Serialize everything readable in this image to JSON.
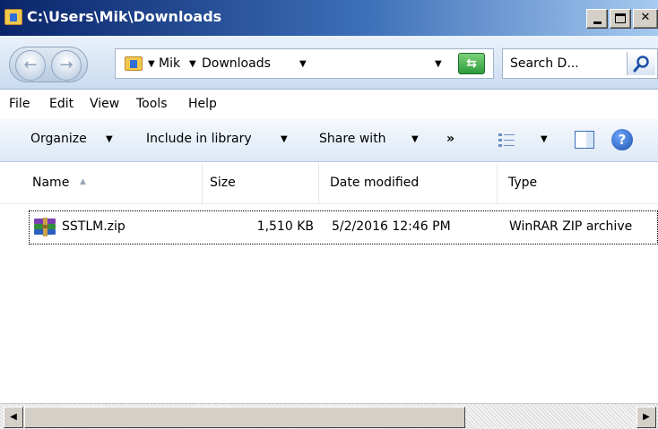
{
  "window": {
    "title": "C:\\Users\\Mik\\Downloads"
  },
  "address": {
    "crumbs": [
      "Mik",
      "Downloads"
    ]
  },
  "search": {
    "placeholder": "Search D..."
  },
  "menu": {
    "items": [
      "File",
      "Edit",
      "View",
      "Tools",
      "Help"
    ]
  },
  "commands": {
    "organize": "Organize",
    "include": "Include in library",
    "share": "Share with",
    "more": "»"
  },
  "columns": {
    "name": "Name",
    "size": "Size",
    "date": "Date modified",
    "type": "Type"
  },
  "files": [
    {
      "name": "SSTLM.zip",
      "size": "1,510 KB",
      "date": "5/2/2016 12:46 PM",
      "type": "WinRAR ZIP archive",
      "icon": "winrar-archive-icon"
    }
  ],
  "colors": {
    "titlebar_start": "#0a246a",
    "titlebar_end": "#a6caf0",
    "toolbar_bg": "#dde8f5"
  }
}
